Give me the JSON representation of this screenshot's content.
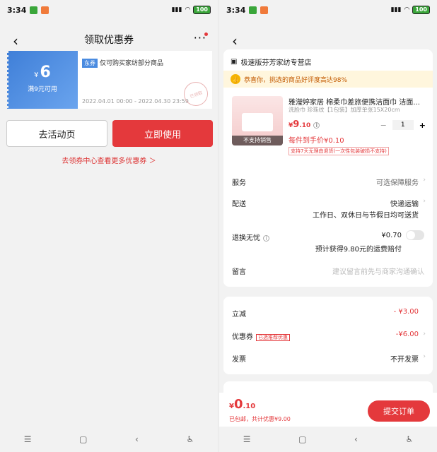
{
  "status": {
    "time": "3:34",
    "battery": "100"
  },
  "left": {
    "title": "领取优惠券",
    "more_icon": "···",
    "coupon": {
      "currency": "¥",
      "amount": "6",
      "condition": "满9元可用",
      "tag": "东券",
      "desc": "仅可购买家纺部分商品",
      "date": "2022.04.01 00:00 - 2022.04.30 23:59",
      "stamp": "已领取"
    },
    "btn_activity": "去活动页",
    "btn_use": "立即使用",
    "more_coupons": "去领券中心查看更多优惠券 ＞"
  },
  "right": {
    "shop": "极速版芬芳家纺专营店",
    "banner": "恭喜你，挑选的商品好评度高达98%",
    "product": {
      "name": "雅瀅婷家居 棉柔巾差旅便携洁面巾 洁面...",
      "spec": "洗脸巾 珍珠纹【1包装】加厚单张15X20cm",
      "price_symbol": "¥",
      "price_int": "9",
      "price_dec": ".10",
      "qty": "1",
      "unit_price": "每件到手价¥0.10",
      "return_note": "支持7天无理由退货(一次性包装破损不支持)",
      "no_sale": "不支持销售"
    },
    "service": {
      "label": "服务",
      "value": "可选保障服务"
    },
    "delivery": {
      "label": "配送",
      "value": "快递运输",
      "sub": "工作日、双休日与节假日均可送货"
    },
    "worry_free": {
      "label": "退换无忧",
      "value": "¥0.70",
      "sub": "预计获得9.80元的运费赔付"
    },
    "note": {
      "label": "留言",
      "placeholder": "建议留言前先与商家沟通确认"
    },
    "discount": {
      "label": "立减",
      "value": "- ¥3.00"
    },
    "coupon": {
      "label": "优惠券",
      "tag": "已选推荐优惠",
      "value": "-¥6.00"
    },
    "invoice": {
      "label": "发票",
      "value": "不开发票"
    },
    "total": {
      "symbol": "¥",
      "int": "0",
      "dec": ".10",
      "savings": "已包邮，共计优惠¥9.00"
    },
    "submit": "提交订单"
  },
  "colors": {
    "accent": "#e4393c",
    "coupon_blue": "#4a8be0"
  }
}
